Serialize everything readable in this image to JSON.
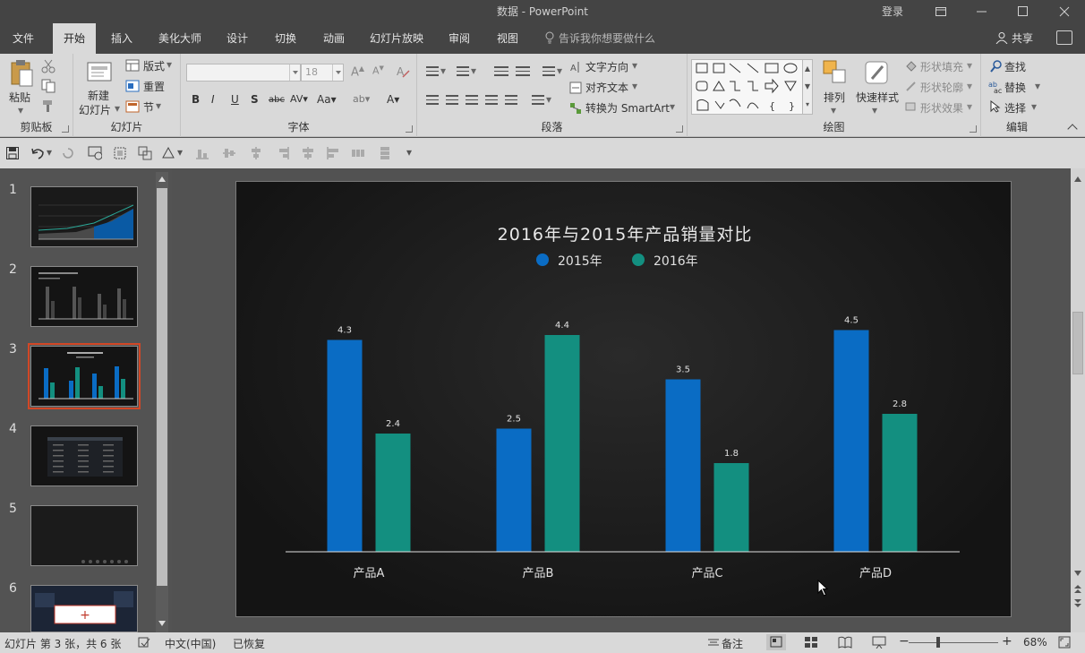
{
  "window": {
    "title": "数据  -  PowerPoint",
    "login": "登录"
  },
  "tabs": [
    {
      "label": "文件",
      "active": false
    },
    {
      "label": "开始",
      "active": true
    },
    {
      "label": "插入",
      "active": false
    },
    {
      "label": "美化大师",
      "active": false
    },
    {
      "label": "设计",
      "active": false
    },
    {
      "label": "切换",
      "active": false
    },
    {
      "label": "动画",
      "active": false
    },
    {
      "label": "幻灯片放映",
      "active": false
    },
    {
      "label": "审阅",
      "active": false
    },
    {
      "label": "视图",
      "active": false
    }
  ],
  "tellme": "告诉我你想要做什么",
  "share": "共享",
  "ribbon": {
    "clipboard": {
      "label": "剪贴板",
      "paste": "粘贴"
    },
    "slides": {
      "label": "幻灯片",
      "new_slide_1": "新建",
      "new_slide_2": "幻灯片",
      "layout": "版式",
      "reset": "重置",
      "section": "节"
    },
    "font": {
      "label": "字体",
      "font_name": "",
      "font_size": "18"
    },
    "paragraph": {
      "label": "段落",
      "text_direction": "文字方向",
      "align_text": "对齐文本",
      "smartart": "转换为 SmartArt"
    },
    "drawing": {
      "label": "绘图",
      "arrange": "排列",
      "quick_styles": "快速样式",
      "shape_fill": "形状填充",
      "shape_outline": "形状轮廓",
      "shape_effects": "形状效果"
    },
    "editing": {
      "label": "编辑",
      "find": "查找",
      "replace": "替换",
      "select": "选择"
    }
  },
  "thumbnails": [
    {
      "num": "1",
      "selected": false
    },
    {
      "num": "2",
      "selected": false
    },
    {
      "num": "3",
      "selected": true
    },
    {
      "num": "4",
      "selected": false
    },
    {
      "num": "5",
      "selected": false
    },
    {
      "num": "6",
      "selected": false
    }
  ],
  "chart_data": {
    "type": "bar",
    "title": "2016年与2015年产品销量对比",
    "categories": [
      "产品A",
      "产品B",
      "产品C",
      "产品D"
    ],
    "series": [
      {
        "name": "2015年",
        "color": "#0a6cc4",
        "values": [
          4.3,
          2.5,
          3.5,
          4.5
        ]
      },
      {
        "name": "2016年",
        "color": "#138f80",
        "values": [
          2.4,
          4.4,
          1.8,
          2.8
        ]
      }
    ],
    "ylim": [
      0,
      5
    ],
    "legend": "top",
    "grid": false,
    "data_labels": true
  },
  "status": {
    "slide_info": "幻灯片 第 3 张，共 6 张",
    "language": "中文(中国)",
    "recovered": "已恢复",
    "notes": "备注",
    "zoom": "68%"
  }
}
